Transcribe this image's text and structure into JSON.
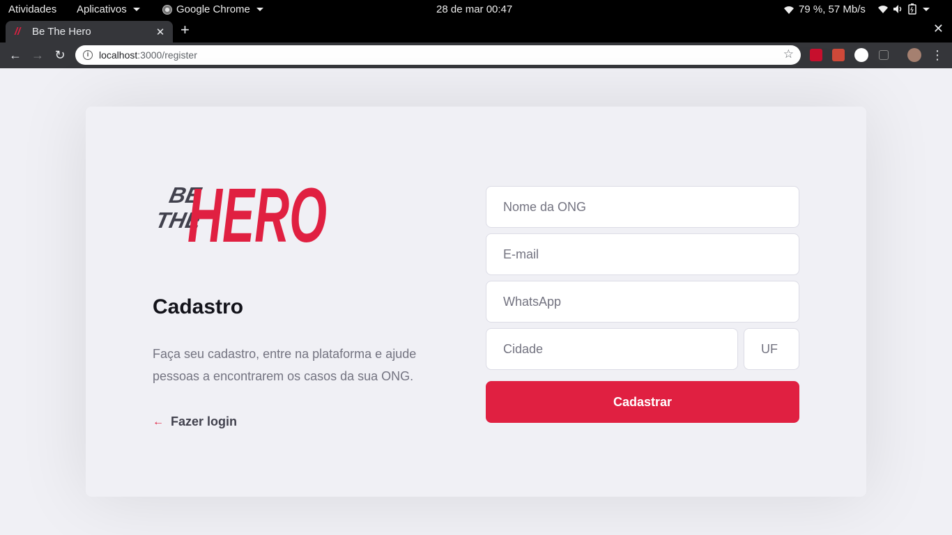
{
  "system_bar": {
    "activities": "Atividades",
    "apps": "Aplicativos",
    "app_name": "Google Chrome",
    "datetime": "28 de mar  00:47",
    "status": "79 %, 57 Mb/s"
  },
  "browser": {
    "tab_title": "Be The Hero",
    "url_host": "localhost",
    "url_path": ":3000/register"
  },
  "brand": {
    "logo_small": [
      "BE",
      "THE"
    ],
    "logo_big": "HERO",
    "accent": "#e02041"
  },
  "page": {
    "title": "Cadastro",
    "description": "Faça seu cadastro, entre na plataforma e ajude pessoas a encontrarem os casos da sua ONG.",
    "back_link": "Fazer login"
  },
  "form": {
    "name_placeholder": "Nome da ONG",
    "email_placeholder": "E-mail",
    "whatsapp_placeholder": "WhatsApp",
    "city_placeholder": "Cidade",
    "uf_placeholder": "UF",
    "submit_label": "Cadastrar"
  }
}
